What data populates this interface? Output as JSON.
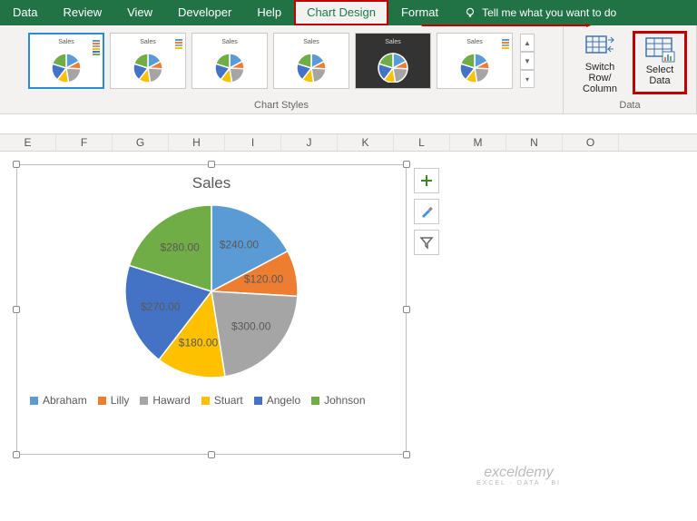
{
  "tabs": {
    "data": "Data",
    "review": "Review",
    "view": "View",
    "developer": "Developer",
    "help": "Help",
    "chart_design": "Chart Design",
    "format": "Format",
    "tell_me": "Tell me what you want to do"
  },
  "ribbon": {
    "chart_styles_label": "Chart Styles",
    "data_group_label": "Data",
    "switch_row_col": "Switch Row/\nColumn",
    "select_data": "Select\nData"
  },
  "columns": [
    "E",
    "F",
    "G",
    "H",
    "I",
    "J",
    "K",
    "L",
    "M",
    "N",
    "O"
  ],
  "chart_side": {
    "add": "+",
    "style": "brush",
    "filter": "filter"
  },
  "watermark": {
    "brand": "exceldemy",
    "tag": "EXCEL · DATA · BI"
  },
  "chart_data": {
    "type": "pie",
    "title": "Sales",
    "series": [
      {
        "name": "Abraham",
        "value": 240.0,
        "label": "$240.00",
        "color": "#5B9BD5"
      },
      {
        "name": "Lilly",
        "value": 120.0,
        "label": "$120.00",
        "color": "#ED7D31"
      },
      {
        "name": "Haward",
        "value": 300.0,
        "label": "$300.00",
        "color": "#A5A5A5"
      },
      {
        "name": "Stuart",
        "value": 180.0,
        "label": "$180.00",
        "color": "#FFC000"
      },
      {
        "name": "Angelo",
        "value": 270.0,
        "label": "$270.00",
        "color": "#4472C4"
      },
      {
        "name": "Johnson",
        "value": 280.0,
        "label": "$280.00",
        "color": "#70AD47"
      }
    ]
  }
}
